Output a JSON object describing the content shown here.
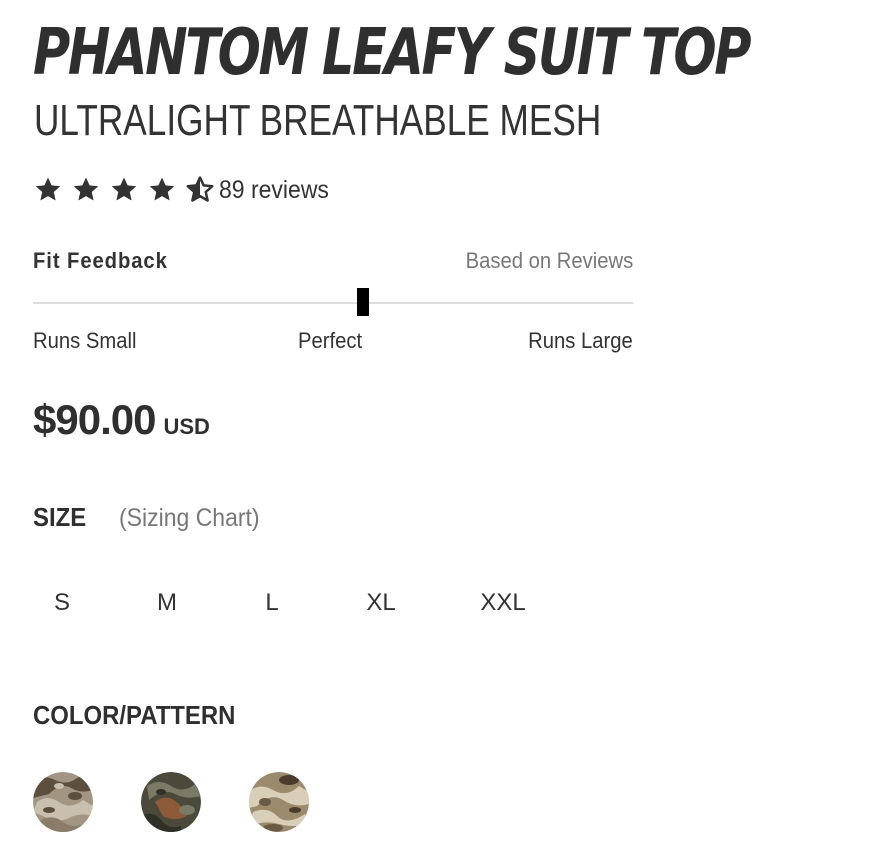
{
  "product": {
    "title": "PHANTOM LEAFY SUIT TOP",
    "subtitle": "ULTRALIGHT BREATHABLE MESH"
  },
  "rating": {
    "value": 4.5,
    "max": 5,
    "star_icons": [
      "star-full-icon",
      "star-full-icon",
      "star-full-icon",
      "star-full-icon",
      "star-half-icon"
    ],
    "review_count_text": "89 reviews"
  },
  "fit_feedback": {
    "title": "Fit Feedback",
    "basis": "Based on Reviews",
    "labels": {
      "small": "Runs Small",
      "perfect": "Perfect",
      "large": "Runs Large"
    },
    "position": 0.55
  },
  "price": {
    "amount": "$90.00",
    "currency": "USD"
  },
  "size": {
    "label": "SIZE",
    "chart_link": "(Sizing Chart)",
    "options": [
      "S",
      "M",
      "L",
      "XL",
      "XXL"
    ]
  },
  "color": {
    "label": "COLOR/PATTERN",
    "swatches": [
      {
        "pattern": "light-mottled-camo",
        "colors": [
          "#8a7c68",
          "#c8bfae",
          "#5c4f3e",
          "#a29581"
        ]
      },
      {
        "pattern": "dark-leafy-camo",
        "colors": [
          "#4b4a3a",
          "#7a7a66",
          "#8f5a3a",
          "#2f3026"
        ]
      },
      {
        "pattern": "tan-desert-camo",
        "colors": [
          "#6b5a44",
          "#d9cfb8",
          "#9c8a6c",
          "#4a3d2e"
        ]
      }
    ]
  },
  "colors": {
    "text_primary": "#333333",
    "text_muted": "#777777",
    "track": "#dddddd",
    "marker": "#000000"
  }
}
